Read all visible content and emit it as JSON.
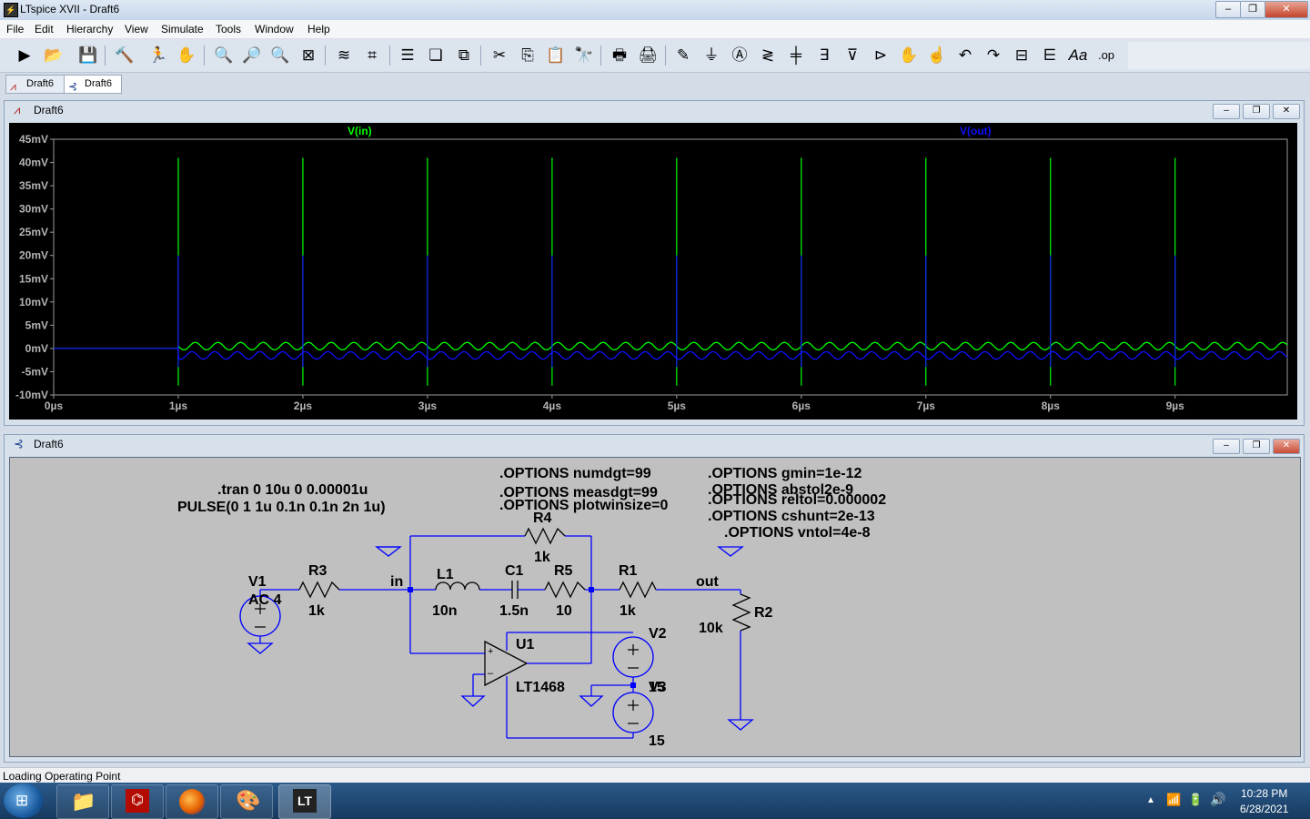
{
  "window": {
    "title": "LTspice XVII - Draft6",
    "btn_min": "–",
    "btn_max": "❐",
    "btn_close": "✕"
  },
  "menu": [
    "File",
    "Edit",
    "Hierarchy",
    "View",
    "Simulate",
    "Tools",
    "Window",
    "Help"
  ],
  "tabs": [
    {
      "label": "Draft6",
      "icon": "waveform-icon"
    },
    {
      "label": "Draft6",
      "icon": "schematic-icon"
    }
  ],
  "waveform_window": {
    "title": "Draft6",
    "traces": [
      {
        "name": "V(in)",
        "color": "#00ff00"
      },
      {
        "name": "V(out)",
        "color": "#1010ff"
      }
    ]
  },
  "chart_data": {
    "type": "line",
    "xlabel": "",
    "ylabel": "",
    "x_ticks": [
      "0µs",
      "1µs",
      "2µs",
      "3µs",
      "4µs",
      "5µs",
      "6µs",
      "7µs",
      "8µs",
      "9µs"
    ],
    "y_ticks": [
      "45mV",
      "40mV",
      "35mV",
      "30mV",
      "25mV",
      "20mV",
      "15mV",
      "10mV",
      "5mV",
      "0mV",
      "-5mV",
      "-10mV"
    ],
    "xlim_us": [
      0,
      9.9
    ],
    "ylim_mV": [
      -10,
      45
    ],
    "series": [
      {
        "name": "V(in)",
        "color": "#00ff00",
        "baseline_mV": 0.5,
        "spike_peak_mV": 41,
        "spike_min_mV": -8,
        "ripple_amp_mV": 0.8,
        "spike_times_us": [
          1,
          2,
          3,
          4,
          5,
          6,
          7,
          8,
          9
        ]
      },
      {
        "name": "V(out)",
        "color": "#1010ff",
        "baseline_mV": -1.5,
        "spike_peak_mV": 20,
        "spike_min_mV": -4,
        "ripple_amp_mV": 0.8,
        "spike_times_us": [
          1,
          2,
          3,
          4,
          5,
          6,
          7,
          8,
          9
        ]
      }
    ]
  },
  "schematic_window": {
    "title": "Draft6",
    "directives": {
      "tran": ".tran 0 10u 0 0.00001u",
      "pulse": "PULSE(0 1 1u 0.1n 0.1n 2n 1u)",
      "opt1": ".OPTIONS numdgt=99",
      "opt2": ".OPTIONS measdgt=99",
      "opt3": ".OPTIONS plotwinsize=0",
      "opt4": ".OPTIONS gmin=1e-12",
      "opt5": ".OPTIONS abstol2e-9",
      "opt6": ".OPTIONS reltol=0.000002",
      "opt7": ".OPTIONS cshunt=2e-13",
      "opt8": ".OPTIONS vntol=4e-8"
    },
    "labels": {
      "V1": "V1",
      "V1_val": "AC 4",
      "R3": "R3",
      "R3_val": "1k",
      "in": "in",
      "L1": "L1",
      "L1_val": "10n",
      "C1": "C1",
      "C1_val": "1.5n",
      "R5": "R5",
      "R5_val": "10",
      "R4": "R4",
      "R4_val": "1k",
      "R1": "R1",
      "R1_val": "1k",
      "out": "out",
      "R2": "R2",
      "R2_val": "10k",
      "U1": "U1",
      "U1_val": "LT1468",
      "V2": "V2",
      "V3": "V3",
      "V2_val": "15",
      "V3_val": "15"
    }
  },
  "status": {
    "text": "Loading Operating Point"
  },
  "taskbar": {
    "time": "10:28 PM",
    "date": "6/28/2021"
  }
}
